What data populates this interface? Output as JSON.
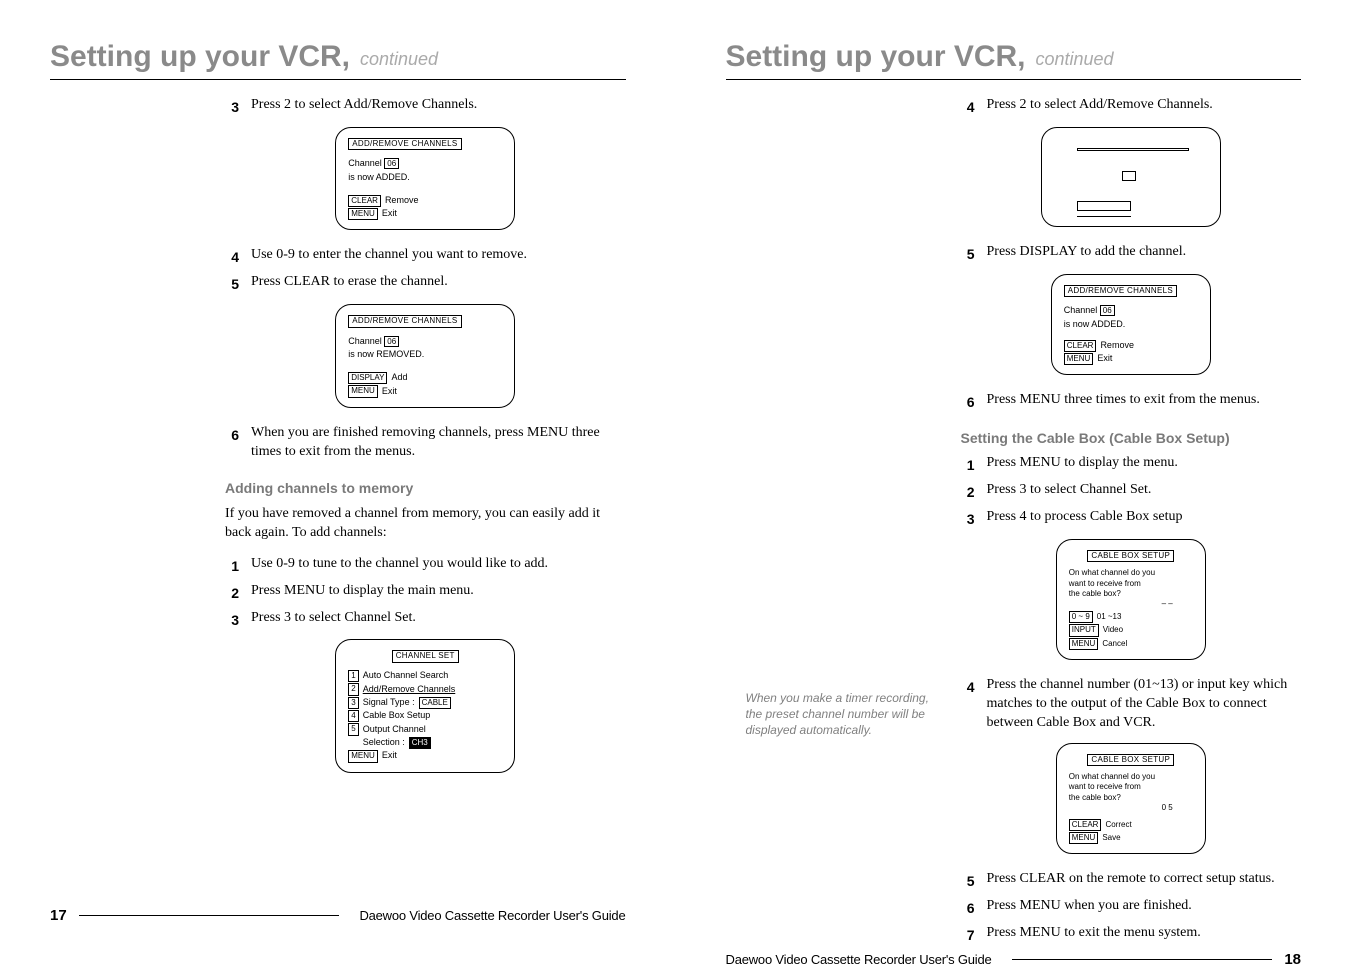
{
  "left": {
    "title_main": "Setting up your VCR,",
    "title_cont": "continued",
    "s3": {
      "num": "3",
      "text": "Press 2 to select Add/Remove Channels."
    },
    "screen1": {
      "hdr": "ADD/REMOVE CHANNELS",
      "l1": "Channel",
      "l1box": "06",
      "l2": "is now ADDED.",
      "b1": "CLEAR",
      "b1t": "Remove",
      "b2": "MENU",
      "b2t": "Exit"
    },
    "s4": {
      "num": "4",
      "text": "Use 0-9 to enter the channel you want to remove."
    },
    "s5": {
      "num": "5",
      "text": "Press CLEAR to erase the channel."
    },
    "screen2": {
      "hdr": "ADD/REMOVE CHANNELS",
      "l1": "Channel",
      "l1box": "06",
      "l2": "is now REMOVED.",
      "b1": "DISPLAY",
      "b1t": "Add",
      "b2": "MENU",
      "b2t": "Exit"
    },
    "s6": {
      "num": "6",
      "text": "When you are finished removing channels, press MENU three times to exit from the menus."
    },
    "sec2": "Adding channels to memory",
    "sec2_para": "If you have removed a channel from memory, you can easily add it back again. To add channels:",
    "a1": {
      "num": "1",
      "text": "Use 0-9 to tune to the channel you would like to add."
    },
    "a2": {
      "num": "2",
      "text": "Press MENU to display the main menu."
    },
    "a3": {
      "num": "3",
      "text": "Press 3 to select Channel Set."
    },
    "screen3": {
      "hdr": "CHANNEL SET",
      "r1n": "1",
      "r1": "Auto Channel Search",
      "r2n": "2",
      "r2": "Add/Remove Channels",
      "r3n": "3",
      "r3": "Signal Type :",
      "r3b": "CABLE",
      "r4n": "4",
      "r4": "Cable Box Setup",
      "r5n": "5",
      "r5": "Output Channel",
      "r5b": "Selection :",
      "r5v": "CH3",
      "b": "MENU",
      "bt": "Exit"
    },
    "footer": "Daewoo Video Cassette Recorder User's Guide",
    "page": "17"
  },
  "right": {
    "title_main": "Setting up your VCR,",
    "title_cont": "continued",
    "s4": {
      "num": "4",
      "text": "Press 2 to select Add/Remove Channels."
    },
    "s5": {
      "num": "5",
      "text": "Press DISPLAY to add the channel."
    },
    "screen1": {
      "hdr": "ADD/REMOVE CHANNELS",
      "l1": "Channel",
      "l1box": "06",
      "l2": "is now ADDED.",
      "b1": "CLEAR",
      "b1t": "Remove",
      "b2": "MENU",
      "b2t": "Exit"
    },
    "s6": {
      "num": "6",
      "text": "Press MENU three times to exit from the menus."
    },
    "sec2": "Setting the Cable Box (Cable Box Setup)",
    "b1": {
      "num": "1",
      "text": "Press MENU to display the menu."
    },
    "b2": {
      "num": "2",
      "text": "Press 3 to select Channel Set."
    },
    "b3": {
      "num": "3",
      "text": "Press 4 to process Cable Box setup"
    },
    "screen2": {
      "hdr": "CABLE BOX SETUP",
      "l1": "On what channel do you",
      "l2": "want to receive from",
      "l3": "the cable box?",
      "dash": "– –",
      "r1b": "0 ~ 9",
      "r1": "01 ~13",
      "r2b": "INPUT",
      "r2": "Video",
      "r3b": "MENU",
      "r3": "Cancel"
    },
    "callout": "When you make a timer recording, the preset channel number will be displayed automatically.",
    "b4": {
      "num": "4",
      "text": "Press the channel number (01~13) or input key which matches to the output of the Cable Box to connect between Cable Box and VCR."
    },
    "screen3": {
      "hdr": "CABLE BOX SETUP",
      "l1": "On what channel do you",
      "l2": "want to receive from",
      "l3": "the cable box?",
      "val": "0 5",
      "r1b": "CLEAR",
      "r1": "Correct",
      "r2b": "MENU",
      "r2": "Save"
    },
    "b5": {
      "num": "5",
      "text": "Press CLEAR on the remote to correct setup status."
    },
    "b6": {
      "num": "6",
      "text": "Press MENU when you are finished."
    },
    "b7": {
      "num": "7",
      "text": "Press MENU to exit the menu system."
    },
    "footer": "Daewoo Video Cassette Recorder User's Guide",
    "page": "18"
  }
}
